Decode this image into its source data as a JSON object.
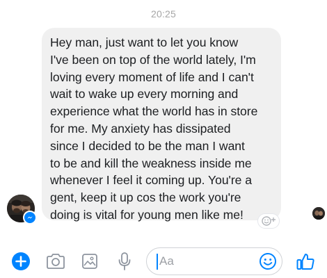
{
  "conversation": {
    "timestamp": "20:25",
    "message": {
      "text": "Hey man, just want to let you know\nI've been on top of the world lately, I'm\nloving every moment of life and I can't\nwait to wake up every morning and\nexperience what the world has in store\nfor me. My anxiety has dissipated\nsince I decided to be the man I want\nto be and kill the weakness inside me\nwhenever I feel it coming up. You're a\ngent, keep it up cos the work you're\ndoing is vital for young men like me!",
      "bubble_color": "#f0f0f0"
    },
    "sender_avatar_icon": "user-avatar-photo",
    "read_receipt_icon": "read-receipt-avatar",
    "reaction_icon": "add-reaction-icon"
  },
  "composer": {
    "input_placeholder": "Aa",
    "input_value": "",
    "actions_icon": "plus-icon",
    "camera_icon": "camera-icon",
    "gallery_icon": "image-icon",
    "voice_icon": "microphone-icon",
    "emoji_icon": "smiley-icon",
    "like_icon": "thumbs-up-icon"
  },
  "colors": {
    "accent": "#0084ff",
    "timestamp": "#a6a6a6",
    "icon_gray": "#8d949e",
    "text": "#1c1e21"
  }
}
